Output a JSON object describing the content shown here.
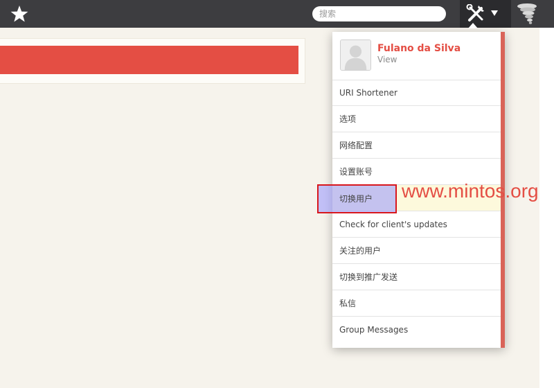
{
  "topbar": {
    "search_placeholder": "搜索",
    "icons": [
      "star-icon",
      "tools-icon",
      "caret-down-icon",
      "tornado-icon"
    ]
  },
  "profile": {
    "name": "Fulano da Silva",
    "view_label": "View"
  },
  "menu": {
    "items": [
      {
        "label": "URI Shortener"
      },
      {
        "label": "选项"
      },
      {
        "label": "网络配置"
      },
      {
        "label": "设置账号"
      },
      {
        "label": "切换用户"
      },
      {
        "label": "Check for client's updates"
      },
      {
        "label": "关注的用户"
      },
      {
        "label": "切换到推广发送"
      },
      {
        "label": "私信"
      },
      {
        "label": "Group Messages"
      }
    ]
  },
  "watermark": "www.mintos.org",
  "colors": {
    "topbar": "#3d3d40",
    "accent_red": "#e44e44",
    "menu_border": "#d96459",
    "highlight_border": "#d8161c",
    "hover_row": "#fdf9dc"
  }
}
